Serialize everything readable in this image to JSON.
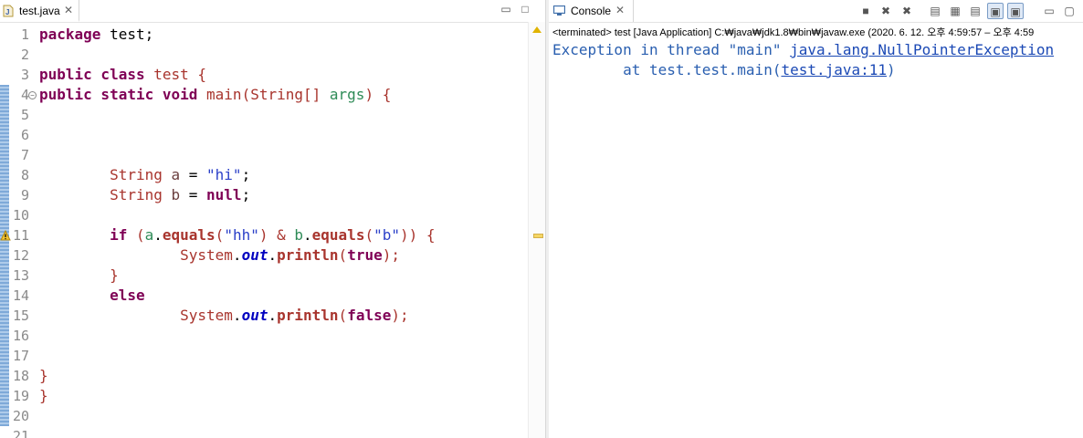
{
  "editor": {
    "tab_label": "test.java",
    "tab_close": "✕",
    "minimize": "▭",
    "maximize": "□",
    "line_numbers": [
      "1",
      "2",
      "3",
      "4",
      "5",
      "6",
      "7",
      "8",
      "9",
      "10",
      "11",
      "12",
      "13",
      "14",
      "15",
      "16",
      "17",
      "18",
      "19",
      "20",
      "21"
    ],
    "fold_marker": "−",
    "code": {
      "l1_kw": "package",
      "l1_rest": " test;",
      "l3_kw": "public class",
      "l3_name": " test ",
      "l3_brace": "{",
      "l4_kw": "public static void",
      "l4_method": " main",
      "l4_paren_open": "(",
      "l4_type": "String[]",
      "l4_param": " args",
      "l4_paren_close": ") ",
      "l4_brace": "{",
      "l8_indent": "        ",
      "l8_type": "String",
      "l8_var": " a",
      "l8_eq": " = ",
      "l8_str": "\"hi\"",
      "l8_end": ";",
      "l9_indent": "        ",
      "l9_type": "String",
      "l9_var": " b",
      "l9_eq": " = ",
      "l9_kw": "null",
      "l9_end": ";",
      "l11_indent": "        ",
      "l11_kw": "if",
      "l11_p1": " (",
      "l11_a": "a",
      "l11_dot1": ".",
      "l11_eq1": "equals",
      "l11_p2": "(",
      "l11_s1": "\"hh\"",
      "l11_p3": ") & ",
      "l11_b": "b",
      "l11_dot2": ".",
      "l11_eq2": "equals",
      "l11_p4": "(",
      "l11_s2": "\"b\"",
      "l11_p5": ")) ",
      "l11_brace": "{",
      "l12_indent": "                ",
      "l12_sys": "System",
      "l12_dot": ".",
      "l12_out": "out",
      "l12_dot2": ".",
      "l12_println": "println",
      "l12_p1": "(",
      "l12_val": "true",
      "l12_p2": ");",
      "l13_indent": "        ",
      "l13_brace": "}",
      "l14_indent": "        ",
      "l14_kw": "else",
      "l15_indent": "                ",
      "l15_sys": "System",
      "l15_dot": ".",
      "l15_out": "out",
      "l15_dot2": ".",
      "l15_println": "println",
      "l15_p1": "(",
      "l15_val": "false",
      "l15_p2": ");",
      "l18_brace": "}",
      "l19_brace": "}"
    }
  },
  "console": {
    "tab_label": "Console",
    "tab_close": "✕",
    "toolbar": [
      "■",
      "✖",
      "✖",
      "▤",
      "▦",
      "▤",
      "▣",
      "▣",
      "▭",
      "▢"
    ],
    "status": "<terminated> test [Java Application] C:₩java₩jdk1.8₩bin₩javaw.exe  (2020. 6. 12. 오후 4:59:57 – 오후 4:59",
    "output": {
      "line1_prefix": "Exception in thread \"main\" ",
      "line1_link": "java.lang.NullPointerException",
      "line2_prefix": "        at test.test.main(",
      "line2_link": "test.java:11",
      "line2_suffix": ")"
    }
  },
  "colors": {
    "keyword": "#7f0055",
    "string": "#2a3fc8",
    "console_text": "#2a5fb0",
    "link": "#1b49b5"
  }
}
